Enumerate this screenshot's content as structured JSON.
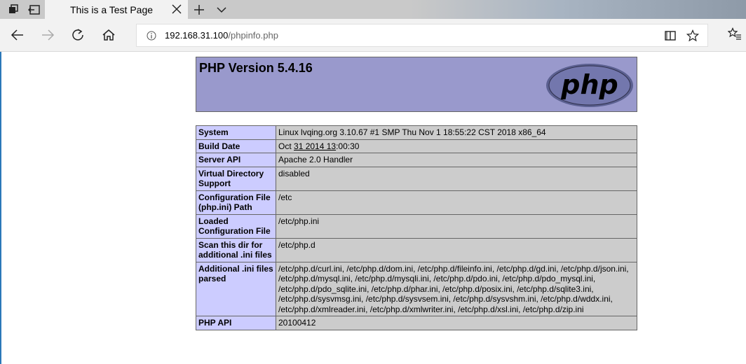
{
  "browser": {
    "tab_title": "This is a Test Page",
    "address_host": "192.168.31.100",
    "address_path": "/phpinfo.php"
  },
  "icons": {
    "tab_actions": "tabs-aside-icon",
    "tab_restore": "set-aside-tabs-icon",
    "tab_close": "close-icon",
    "new_tab": "plus-icon",
    "tab_menu": "chevron-down-icon",
    "back": "back-arrow-icon",
    "forward": "forward-arrow-icon",
    "refresh": "refresh-icon",
    "home": "home-icon",
    "site_info": "info-icon",
    "reading_view": "book-icon",
    "favorite": "star-icon",
    "favorites_bar": "favorites-list-icon"
  },
  "phpinfo": {
    "title": "PHP Version 5.4.16",
    "logo_text": "php",
    "rows": [
      {
        "label": "System",
        "value": "Linux lvqing.org 3.10.67 #1 SMP Thu Nov 1 18:55:22 CST 2018 x86_64"
      },
      {
        "label": "Build Date",
        "value_parts": [
          "Oct ",
          "31 2014 13",
          ":00:30"
        ]
      },
      {
        "label": "Server API",
        "value": "Apache 2.0 Handler"
      },
      {
        "label": "Virtual Directory Support",
        "value": "disabled"
      },
      {
        "label": "Configuration File (php.ini) Path",
        "value": "/etc"
      },
      {
        "label": "Loaded Configuration File",
        "value": "/etc/php.ini"
      },
      {
        "label": "Scan this dir for additional .ini files",
        "value": "/etc/php.d"
      },
      {
        "label": "Additional .ini files parsed",
        "value": "/etc/php.d/curl.ini, /etc/php.d/dom.ini, /etc/php.d/fileinfo.ini, /etc/php.d/gd.ini, /etc/php.d/json.ini, /etc/php.d/mysql.ini, /etc/php.d/mysqli.ini, /etc/php.d/pdo.ini, /etc/php.d/pdo_mysql.ini, /etc/php.d/pdo_sqlite.ini, /etc/php.d/phar.ini, /etc/php.d/posix.ini, /etc/php.d/sqlite3.ini, /etc/php.d/sysvmsg.ini, /etc/php.d/sysvsem.ini, /etc/php.d/sysvshm.ini, /etc/php.d/wddx.ini, /etc/php.d/xmlreader.ini, /etc/php.d/xmlwriter.ini, /etc/php.d/xsl.ini, /etc/php.d/zip.ini"
      },
      {
        "label": "PHP API",
        "value": "20100412"
      }
    ]
  },
  "colors": {
    "header_bg": "#9999cc",
    "label_bg": "#ccccff",
    "value_bg": "#cccccc",
    "accent": "#2b78b9"
  }
}
